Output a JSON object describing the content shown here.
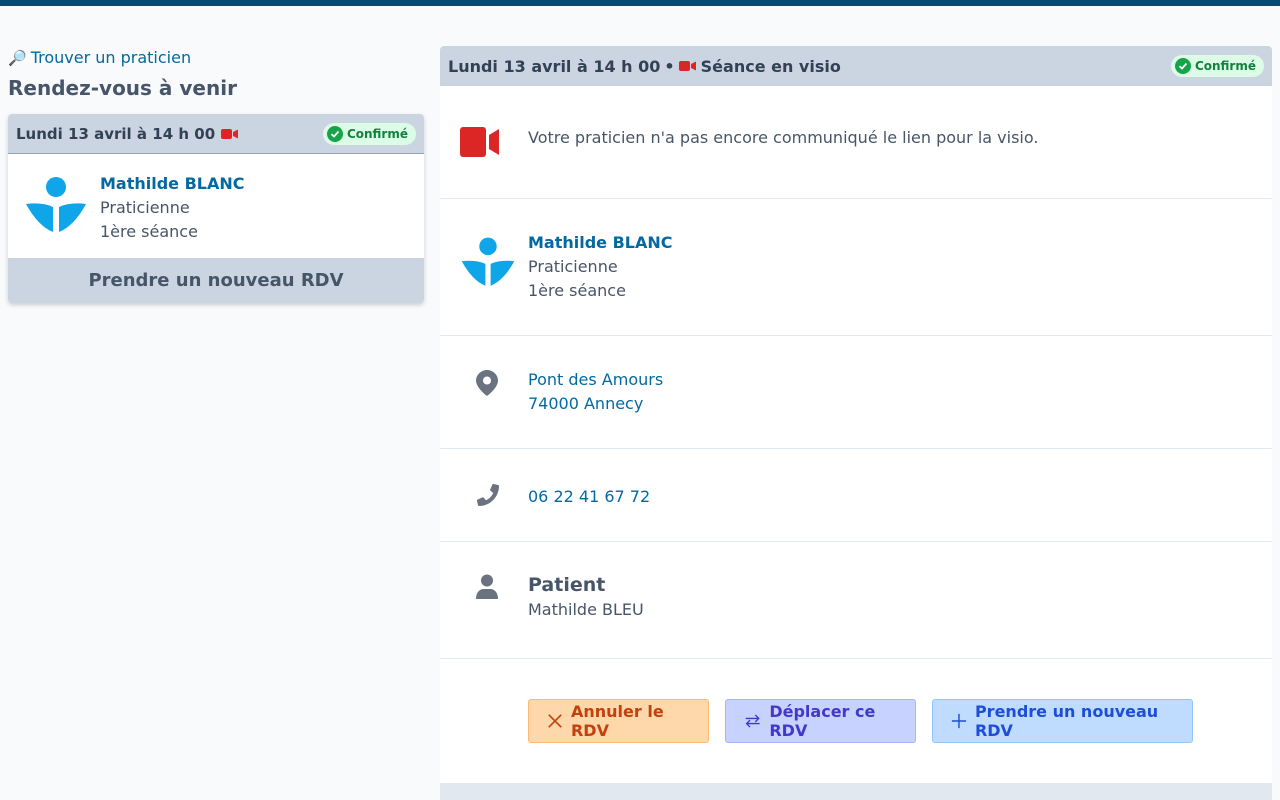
{
  "colors": {
    "primary_link": "#0369a1",
    "header_bg": "#cbd5e1",
    "confirmed_bg": "#dcfce7",
    "confirmed_text": "#15803d",
    "video_red": "#dc2626",
    "logo_blue": "#0ea5e9"
  },
  "sidebar": {
    "find_link": "Trouver un praticien",
    "section_title": "Rendez-vous à venir",
    "card": {
      "date": "Lundi 13 avril à 14 h 00",
      "status": "Confirmé",
      "practitioner_name": "Mathilde BLANC",
      "role": "Praticienne",
      "session": "1ère séance",
      "new_appointment": "Prendre un nouveau RDV"
    }
  },
  "detail": {
    "header": {
      "date": "Lundi 13 avril à 14 h 00",
      "separator": "•",
      "mode": "Séance en visio",
      "status": "Confirmé"
    },
    "video_message": "Votre praticien n'a pas encore communiqué le lien pour la visio.",
    "practitioner": {
      "name": "Mathilde BLANC",
      "role": "Praticienne",
      "session": "1ère séance"
    },
    "address": {
      "line1": "Pont des Amours",
      "line2": "74000 Annecy"
    },
    "phone": "06 22 41 67 72",
    "patient": {
      "title": "Patient",
      "name": "Mathilde BLEU"
    },
    "actions": {
      "cancel": "Annuler le RDV",
      "move": "Déplacer ce RDV",
      "new": "Prendre un nouveau RDV"
    }
  }
}
